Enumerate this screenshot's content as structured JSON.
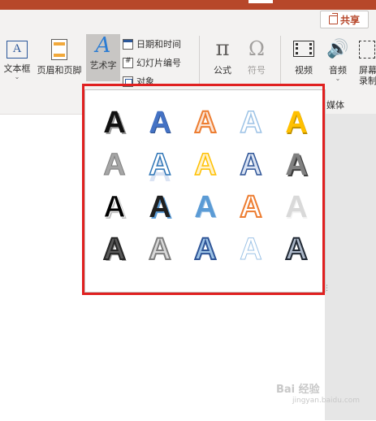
{
  "header": {
    "share_label": "共享"
  },
  "ribbon": {
    "text_box": "文本框",
    "header_footer": "页眉和页脚",
    "wordart": "艺术字",
    "date_time": "日期和时间",
    "slide_number": "幻灯片编号",
    "object": "对象",
    "equation": "公式",
    "symbol": "符号",
    "video": "视频",
    "audio": "音频",
    "screen_recording": "屏幕录制",
    "media_group": "媒体",
    "wordart_icon_glyph": "A",
    "equation_glyph": "π",
    "symbol_glyph": "Ω",
    "audio_glyph": "🔊"
  },
  "wordart_gallery": {
    "glyph": "A",
    "styles": [
      "s0",
      "s1",
      "s2",
      "s3",
      "s4",
      "s5",
      "s6",
      "s7",
      "s8",
      "s9",
      "s10",
      "s11",
      "s12",
      "s13",
      "s14",
      "s15",
      "s16",
      "s17",
      "s18",
      "s19"
    ]
  },
  "colors": {
    "accent": "#b7472a",
    "highlight": "#e02020"
  },
  "watermark": {
    "text": "Bai 经验",
    "url": "jingyan.baidu.com"
  }
}
